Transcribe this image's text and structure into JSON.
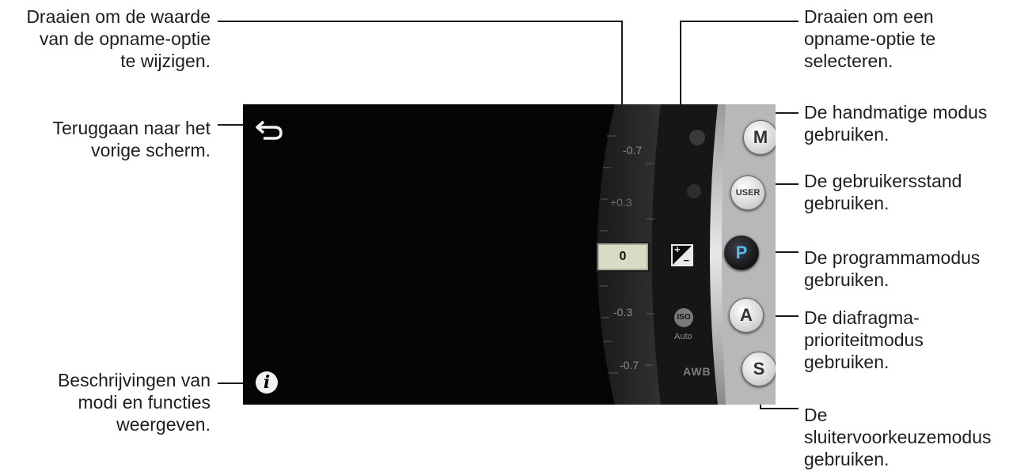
{
  "callouts": {
    "change_value": [
      "Draaien om de waarde",
      "van de opname-optie",
      "te wijzigen."
    ],
    "back": [
      "Teruggaan naar het",
      "vorige scherm."
    ],
    "info": [
      "Beschrijvingen van",
      "modi en functies",
      "weergeven."
    ],
    "select_option": [
      "Draaien om een",
      "opname-optie te",
      "selecteren."
    ],
    "manual": [
      "De handmatige modus",
      "gebruiken."
    ],
    "user": [
      "De gebruikersstand",
      "gebruiken."
    ],
    "program": [
      "De programmamodus",
      "gebruiken."
    ],
    "aperture": [
      "De diafragma-",
      "prioriteitmodus",
      "gebruiken."
    ],
    "shutter": [
      "De",
      "sluitervoorkeuzemodus",
      "gebruiken."
    ]
  },
  "camera": {
    "value": "0",
    "scale": [
      "-0.7",
      "+0.3",
      "-0.3",
      "-0.7"
    ],
    "iso_icon": "ISO",
    "iso_label": "Auto",
    "awb_label": "AWB",
    "modes": [
      "M",
      "USER",
      "P",
      "A",
      "S"
    ],
    "active_mode": "P",
    "icons": [
      "back-arrow-icon",
      "info-icon",
      "exposure-icon",
      "iso-icon",
      "awb-icon"
    ],
    "accent_color": "#5ab8f0"
  }
}
